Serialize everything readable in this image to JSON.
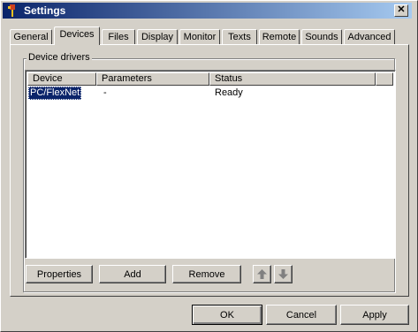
{
  "window": {
    "title": "Settings"
  },
  "tabs": [
    {
      "label": "General"
    },
    {
      "label": "Devices"
    },
    {
      "label": "Files"
    },
    {
      "label": "Display"
    },
    {
      "label": "Monitor"
    },
    {
      "label": "Texts"
    },
    {
      "label": "Remote"
    },
    {
      "label": "Sounds"
    },
    {
      "label": "Advanced"
    }
  ],
  "active_tab": "Devices",
  "group": {
    "label": "Device drivers"
  },
  "table": {
    "columns": [
      "Device",
      "Parameters",
      "Status"
    ],
    "rows": [
      {
        "device": "PC/FlexNet",
        "parameters": "-",
        "status": "Ready"
      }
    ]
  },
  "group_buttons": {
    "properties": "Properties",
    "add": "Add",
    "remove": "Remove"
  },
  "icons": {
    "app": "app-icon",
    "close": "close-icon",
    "up": "arrow-up-icon",
    "down": "arrow-down-icon"
  },
  "dialog_buttons": {
    "ok": "OK",
    "cancel": "Cancel",
    "apply": "Apply"
  },
  "colors": {
    "title_start": "#0a246a",
    "title_end": "#a6caf0",
    "selection": "#0a246a",
    "face": "#d4d0c8"
  }
}
